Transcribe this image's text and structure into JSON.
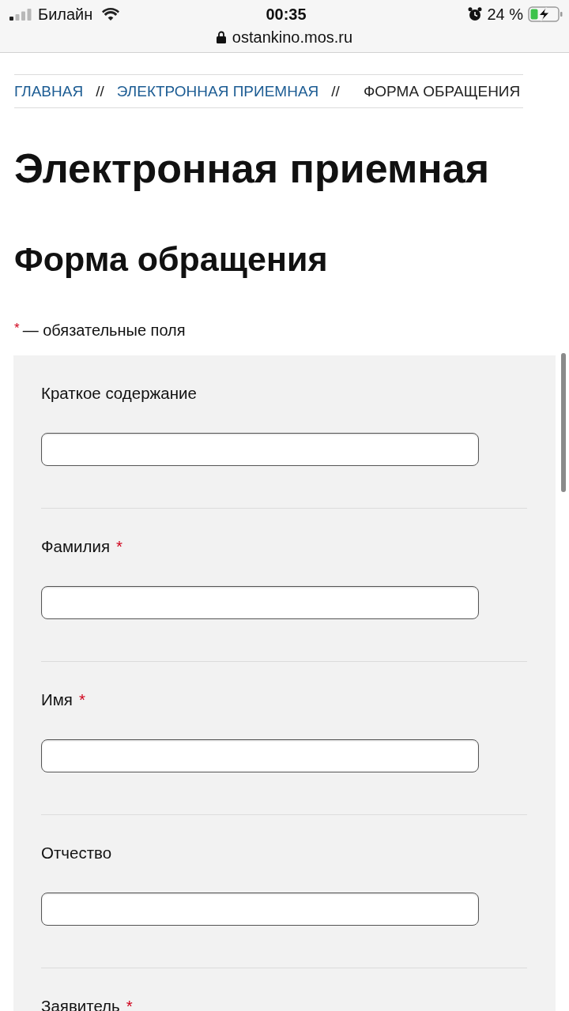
{
  "status_bar": {
    "carrier": "Билайн",
    "time": "00:35",
    "battery": "24 %",
    "charging": true
  },
  "browser": {
    "url": "ostankino.mos.ru"
  },
  "breadcrumbs": [
    {
      "kind": "link",
      "label": "ГЛАВНАЯ"
    },
    {
      "kind": "separator",
      "label": "//"
    },
    {
      "kind": "link",
      "label": "ЭЛЕКТРОННАЯ ПРИЕМНАЯ"
    },
    {
      "kind": "separator",
      "label": "//"
    },
    {
      "kind": "current",
      "label": "ФОРМА ОБРАЩЕНИЯ"
    }
  ],
  "title": "Электронная приемная",
  "subtitle": "Форма обращения",
  "required_note": {
    "mark": "*",
    "text": "— обязательные поля"
  },
  "form": {
    "fields": [
      {
        "kind": "input",
        "label": "Краткое содержание"
      },
      {
        "kind": "input",
        "label": "Фамилия",
        "mark": "*"
      },
      {
        "kind": "input",
        "label": "Имя",
        "mark": "*"
      },
      {
        "kind": "input",
        "label": "Отчество"
      },
      {
        "kind": "label_only",
        "label": "Заявитель",
        "mark": "*"
      }
    ]
  }
}
